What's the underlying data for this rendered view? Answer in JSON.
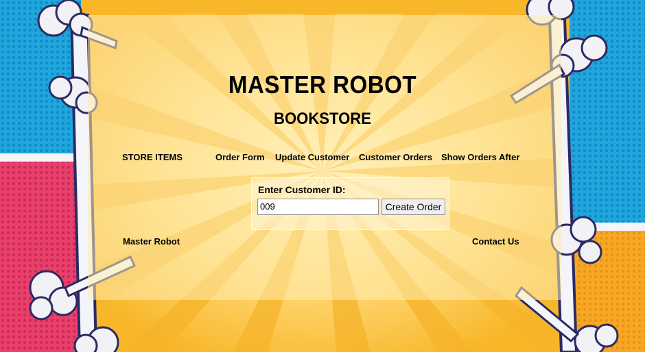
{
  "header": {
    "title": "MASTER ROBOT",
    "subtitle": "BOOKSTORE"
  },
  "nav": {
    "store_items": "STORE ITEMS",
    "order_form": "Order Form",
    "update_customer": "Update Customer",
    "customer_orders": "Customer Orders",
    "show_orders_after": "Show Orders After"
  },
  "form": {
    "label": "Enter Customer ID:",
    "customer_id_value": "009",
    "submit_label": "Create Order"
  },
  "footer": {
    "left_text": "Master Robot",
    "contact_label": "Contact Us"
  },
  "colors": {
    "background_orange": "#f6b72c",
    "background_blue": "#1fa6dd",
    "background_pink": "#e83f6b",
    "panel_cream": "#ffecb0",
    "frame_white": "#f4f4fb",
    "frame_outline": "#2c2a63"
  }
}
